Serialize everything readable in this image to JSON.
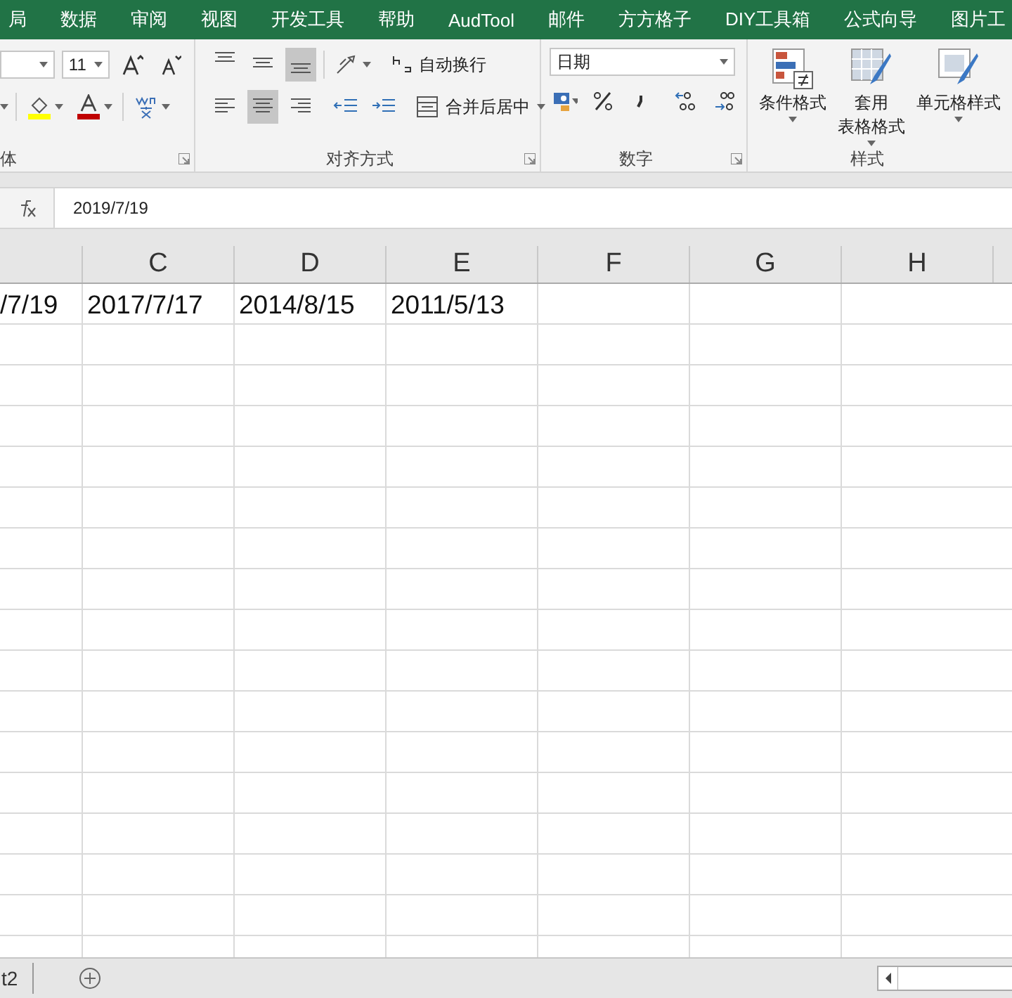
{
  "menu_tabs": [
    "局",
    "数据",
    "审阅",
    "视图",
    "开发工具",
    "帮助",
    "AudTool",
    "邮件",
    "方方格子",
    "DIY工具箱",
    "公式向导",
    "图片工"
  ],
  "ribbon": {
    "font": {
      "label": "体",
      "size": "11"
    },
    "alignment": {
      "label": "对齐方式",
      "vertical": [
        {
          "kind": "top",
          "selected": false
        },
        {
          "kind": "middle",
          "selected": false
        },
        {
          "kind": "bottom",
          "selected": true
        }
      ],
      "horizontal": [
        {
          "kind": "left",
          "selected": false
        },
        {
          "kind": "center",
          "selected": true
        },
        {
          "kind": "right",
          "selected": false
        }
      ],
      "wrap_text": "自动换行",
      "merge": "合并后居中"
    },
    "number": {
      "label": "数字",
      "format": "日期"
    },
    "styles": {
      "label": "样式",
      "buttons": [
        {
          "lines": [
            "条件格式"
          ],
          "kind": "conditional"
        },
        {
          "lines": [
            "套用",
            "表格格式"
          ],
          "kind": "table"
        },
        {
          "lines": [
            "单元格样式"
          ],
          "kind": "cell"
        }
      ]
    }
  },
  "formula_bar": {
    "value": "2019/7/19"
  },
  "columns": [
    "C",
    "D",
    "E",
    "F",
    "G",
    "H"
  ],
  "rows": [
    {
      "cells": [
        "/7/19",
        "2017/7/17",
        "2014/8/15",
        "2011/5/13"
      ]
    }
  ],
  "sheet_tabs": [
    "t2"
  ]
}
